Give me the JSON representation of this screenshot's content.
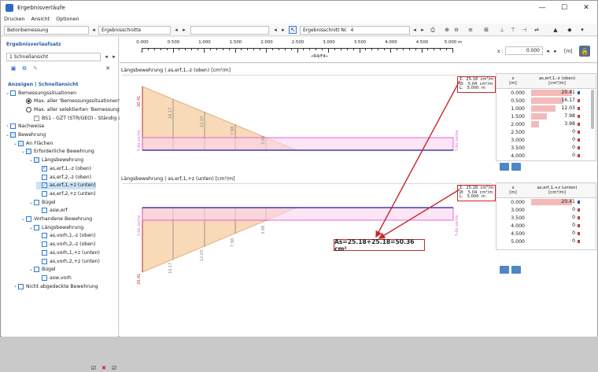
{
  "window": {
    "title": "Ergebnisverläufe",
    "minimize": "—",
    "maximize": "☐",
    "close": "✕"
  },
  "menu": [
    "Drucken",
    "Ansicht",
    "Optionen"
  ],
  "toolbar": {
    "design": "Betonbemessung",
    "sections": "Ergebnisschnitte",
    "empty": "",
    "section_label": "Ergebnisschnitt Nr.",
    "section_no": "4"
  },
  "ruler": {
    "ticks": [
      "0.000",
      "0.500",
      "1.000",
      "1.500",
      "2.000",
      "2.500",
      "3.000",
      "3.500",
      "4.000",
      "4.500",
      "5.000 m"
    ],
    "name": "«R4/F4»",
    "x_label": "x :",
    "x_value": "0.000",
    "unit": "[m]"
  },
  "left": {
    "heading1": "Ergebnisverlaufsatz",
    "set": "1   Schnellansicht",
    "heading2": "Anzeigen | Schnellansicht",
    "tree": [
      {
        "label": "Bemessungssituationen",
        "kind": "cb",
        "tw": "v"
      },
      {
        "label": "Max. aller 'Bemessungssituationen'",
        "kind": "radio-on"
      },
      {
        "label": "Max. aller selektierten 'Bemessungssit...",
        "kind": "radio"
      },
      {
        "label": "BS1 - GZT (STR/GEO) - Ständig u...",
        "kind": "cb-check-grey"
      },
      {
        "label": "Nachweise",
        "kind": "cb",
        "tw": ">"
      },
      {
        "label": "Bewehrung",
        "kind": "cb-fill",
        "tw": "v"
      },
      {
        "label": "An Flächen",
        "kind": "cb-fill",
        "tw": "v"
      },
      {
        "label": "Erforderliche Bewehrung",
        "kind": "cb-fill",
        "tw": "v"
      },
      {
        "label": "Längsbewehrung",
        "kind": "cb-fill",
        "tw": "v"
      },
      {
        "label": "as,erf,1,-z (oben)",
        "kind": "cb-check"
      },
      {
        "label": "as,erf,2,-z (oben)",
        "kind": "cb"
      },
      {
        "label": "as,erf,1,+z (unten)",
        "kind": "cb-check",
        "selected": true
      },
      {
        "label": "as,erf,2,+z (unten)",
        "kind": "cb"
      },
      {
        "label": "Bügel",
        "kind": "cb",
        "tw": "v"
      },
      {
        "label": "asw,erf",
        "kind": "cb"
      },
      {
        "label": "Vorhandene Bewehrung",
        "kind": "cb",
        "tw": "v"
      },
      {
        "label": "Längsbewehrung",
        "kind": "cb",
        "tw": "v"
      },
      {
        "label": "as,vorh,1,-z (oben)",
        "kind": "cb"
      },
      {
        "label": "as,vorh,2,-z (oben)",
        "kind": "cb"
      },
      {
        "label": "as,vorh,1,+z (unten)",
        "kind": "cb"
      },
      {
        "label": "as,vorh,2,+z (unten)",
        "kind": "cb"
      },
      {
        "label": "Bügel",
        "kind": "cb",
        "tw": "v"
      },
      {
        "label": "asw,vorh",
        "kind": "cb"
      },
      {
        "label": "Nicht abgedeckte Bewehrung",
        "kind": "cb",
        "tw": ">"
      }
    ]
  },
  "top": {
    "title": "Längsbewehrung | as,erf,1,-z (oben) [cm²/m]",
    "legend": "Σ:  25.18  cm²/m\nØ:   5.04  cm²/m\nL:   5.000  m",
    "labels": {
      "start": "20.41",
      "v1": "16.17",
      "v2": "12.03",
      "v3": "7.98",
      "v4": "3.98",
      "avg_left": "5.04 cm²/m",
      "avg_right": "5.04 cm²/m"
    },
    "table": {
      "col_x": "x",
      "col_x_unit": "[m]",
      "col_v": "as,erf,1,-z (oben)",
      "col_v_unit": "[cm²/m]",
      "rows": [
        {
          "x": "0.000",
          "v": "20.41",
          "pct": 100
        },
        {
          "x": "0.500",
          "v": "16.17",
          "pct": 79
        },
        {
          "x": "1.000",
          "v": "12.03",
          "pct": 59
        },
        {
          "x": "1.500",
          "v": "7.98",
          "pct": 39
        },
        {
          "x": "2.000",
          "v": "3.98",
          "pct": 20
        },
        {
          "x": "2.500",
          "v": "0",
          "pct": 0
        },
        {
          "x": "3.000",
          "v": "0",
          "pct": 0
        },
        {
          "x": "3.500",
          "v": "0",
          "pct": 0
        },
        {
          "x": "4.000",
          "v": "0",
          "pct": 0
        }
      ]
    }
  },
  "bottom": {
    "title": "Längsbewehrung | as,erf,1,+z (unten) [cm²/m]",
    "legend": "Σ:  25.18  cm²/m\nØ:   5.04  cm²/m\nL:   5.000  m",
    "labels": {
      "start": "20.41",
      "v1": "16.17",
      "v2": "12.03",
      "v3": "7.98",
      "v4": "3.98",
      "avg_left": "5.04 cm²/m",
      "avg_right": "5.04 cm²/m"
    },
    "table": {
      "col_x": "x",
      "col_x_unit": "[m]",
      "col_v": "as,erf,1,+z (unten)",
      "col_v_unit": "[cm²/m]",
      "rows": [
        {
          "x": "0.000",
          "v": "20.41",
          "pct": 100
        },
        {
          "x": "3.000",
          "v": "0",
          "pct": 0
        },
        {
          "x": "3.500",
          "v": "0",
          "pct": 0
        },
        {
          "x": "4.000",
          "v": "0",
          "pct": 0
        },
        {
          "x": "4.500",
          "v": "0",
          "pct": 0
        },
        {
          "x": "5.000",
          "v": "0",
          "pct": 0
        }
      ]
    }
  },
  "formula": "As=25.18+25.18=50.36 cm²",
  "colors": {
    "fill": "#f8d9b8",
    "fill_line": "#e0a070",
    "avg": "#e645c8",
    "axis": "#1a1aa0",
    "arrow": "#c62828"
  }
}
